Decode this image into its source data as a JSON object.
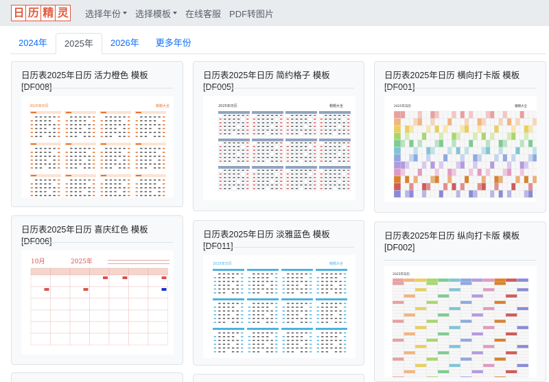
{
  "logo": {
    "chars": [
      "日",
      "历",
      "精",
      "灵"
    ]
  },
  "nav": {
    "items": [
      {
        "label": "选择年份",
        "dropdown": true
      },
      {
        "label": "选择模板",
        "dropdown": true
      },
      {
        "label": "在线客服",
        "dropdown": false
      },
      {
        "label": "PDF转图片",
        "dropdown": false
      }
    ]
  },
  "tabs": [
    {
      "label": "2024年",
      "active": false
    },
    {
      "label": "2025年",
      "active": true
    },
    {
      "label": "2026年",
      "active": false
    },
    {
      "label": "更多年份",
      "active": false
    }
  ],
  "cards": [
    {
      "title": "日历表2025年日历 活力橙色 模板[DF008]",
      "thumb_title": "2025年日历",
      "thumb_brand": "帽帽大全",
      "accent": "#e8742e"
    },
    {
      "title": "日历表2025年日历 简约格子 模板[DF005]",
      "thumb_title": "2025年日历",
      "thumb_brand": "帽帽大全",
      "accent": "#8ea3bd"
    },
    {
      "title": "日历表2025年日历 横向打卡版 模板[DF001]",
      "thumb_title": "2025年日历",
      "thumb_brand": "帽帽大全",
      "accent": "#6c8fc7"
    },
    {
      "title": "日历表2025年日历 喜庆红色 模板[DF006]",
      "thumb_month": "10月",
      "thumb_year": "2025年",
      "accent": "#d9534f"
    },
    {
      "title": "日历表2025年日历 淡雅蓝色 模板[DF011]",
      "thumb_title": "2025年日历",
      "thumb_brand": "帽帽大全",
      "accent": "#4bb3e0"
    },
    {
      "title": "日历表2025年日历 纵向打卡版 模板[DF002]",
      "thumb_title": "2025年日历",
      "accent": "#9b7fd0"
    }
  ]
}
